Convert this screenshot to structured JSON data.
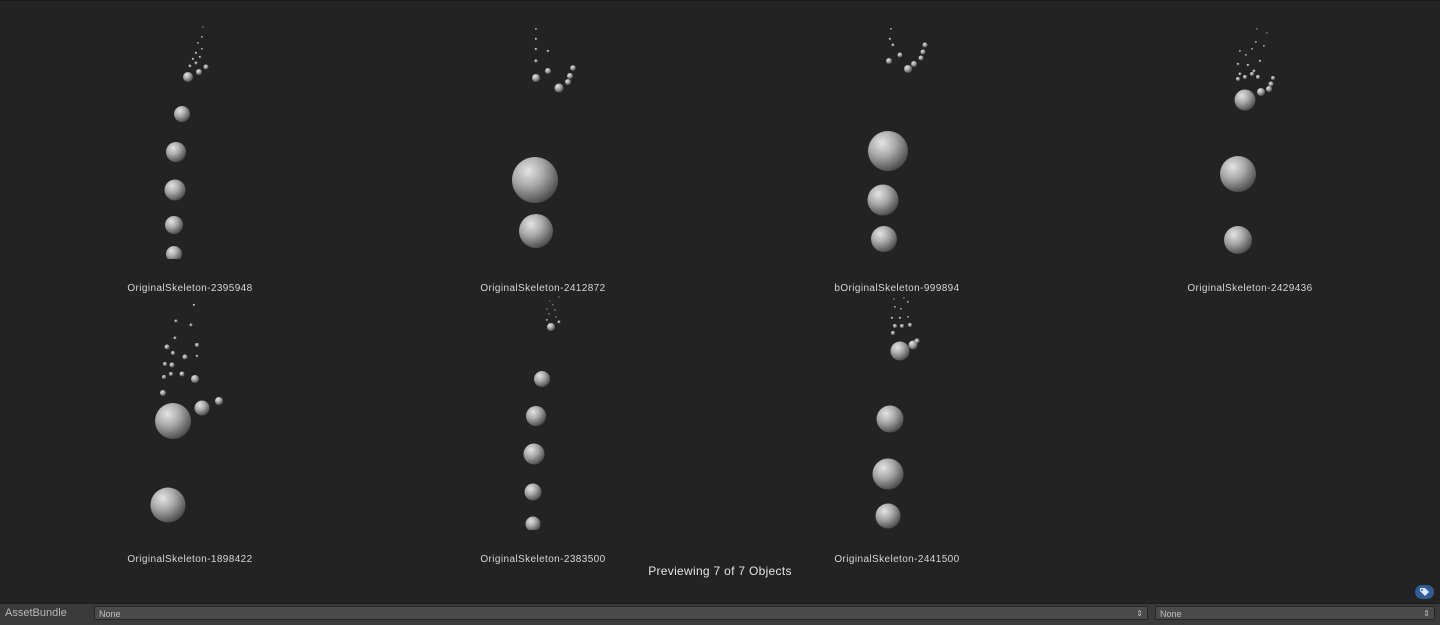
{
  "preview": {
    "objects": [
      {
        "name": "OriginalSkeleton-2395948"
      },
      {
        "name": "OriginalSkeleton-2412872"
      },
      {
        "name": "bOriginalSkeleton-999894"
      },
      {
        "name": "OriginalSkeleton-2429436"
      },
      {
        "name": "OriginalSkeleton-1898422"
      },
      {
        "name": "OriginalSkeleton-2383500"
      },
      {
        "name": "OriginalSkeleton-2441500"
      }
    ],
    "count_text": "Previewing 7 of 7 Objects"
  },
  "bottom_bar": {
    "label": "AssetBundle",
    "bundle_name": {
      "value": "None"
    },
    "bundle_variant": {
      "value": "None"
    }
  },
  "icons": {
    "tag": "tag-icon",
    "dropdown_arrow": "updown-arrow-icon"
  },
  "colors": {
    "background": "#232323",
    "sphere": "#a8a8a8",
    "tag_button": "#2f5d9a"
  }
}
